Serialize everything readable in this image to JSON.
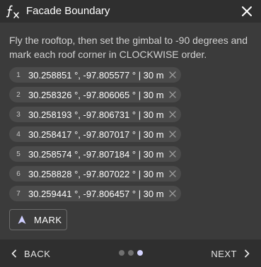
{
  "header": {
    "title": "Facade Boundary",
    "icon": "function-icon"
  },
  "instructions": "Fly the rooftop, then set the gimbal to -90 degrees and mark each roof corner in CLOCKWISE order.",
  "points": [
    {
      "index": "1",
      "text": "30.258851 °, -97.805577 ° | 30 m"
    },
    {
      "index": "2",
      "text": "30.258326 °, -97.806065 ° | 30 m"
    },
    {
      "index": "3",
      "text": "30.258193 °, -97.806731 ° | 30 m"
    },
    {
      "index": "4",
      "text": "30.258417 °, -97.807017 ° | 30 m"
    },
    {
      "index": "5",
      "text": "30.258574 °, -97.807184 ° | 30 m"
    },
    {
      "index": "6",
      "text": "30.258828 °, -97.807022 ° | 30 m"
    },
    {
      "index": "7",
      "text": "30.259441 °, -97.806457 ° | 30 m"
    }
  ],
  "mark_button": {
    "label": "MARK",
    "icon": "navigation-arrow-icon"
  },
  "footer": {
    "back_label": "BACK",
    "next_label": "NEXT",
    "steps_total": 3,
    "step_current": 3
  },
  "colors": {
    "panel": "#3b3b3b",
    "header": "#2f2f2f",
    "chip": "#4b4b4b",
    "active_dot": "#d4d4ff",
    "inactive_dot": "#707070"
  }
}
